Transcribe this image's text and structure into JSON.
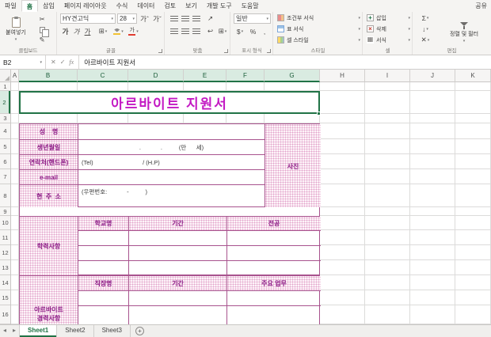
{
  "ribbon": {
    "tabs": [
      {
        "label": "파일"
      },
      {
        "label": "홈"
      },
      {
        "label": "삽입"
      },
      {
        "label": "페이지 레이아웃"
      },
      {
        "label": "수식"
      },
      {
        "label": "데이터"
      },
      {
        "label": "검토"
      },
      {
        "label": "보기"
      },
      {
        "label": "개발 도구"
      },
      {
        "label": "도움말"
      }
    ],
    "active_tab": "홈",
    "share_label": "공유",
    "clipboard": {
      "paste": "붙여넣기",
      "group_label": "클립보드"
    },
    "font": {
      "name": "HY견고딕",
      "size": "28",
      "group_label": "글꼴"
    },
    "alignment": {
      "group_label": "맞춤"
    },
    "number": {
      "format": "일반",
      "group_label": "표시 형식"
    },
    "styles": {
      "buttons": [
        "조건부 서식",
        "표 서식",
        "셀 스타일"
      ],
      "group_label": "스타일"
    },
    "cells": {
      "buttons": [
        "삽입",
        "삭제",
        "서식"
      ],
      "group_label": "셀"
    },
    "editing": {
      "sort_filter": "정렬 및 필터",
      "group_label": "편집"
    }
  },
  "icons": {
    "dropdown": "▾",
    "cut": "✂",
    "format_painter": "✎",
    "font_grow": "가ˆ",
    "font_shrink": "가ˇ",
    "bold": "가",
    "italic": "가",
    "underline": "가",
    "borders": "⊞",
    "font_color": "가",
    "orientation": "↗",
    "wrap_text": "↩",
    "merge": "⊞",
    "currency": "$",
    "percent": "%",
    "comma": ",",
    "sigma": "Σ",
    "fill_down": "↓",
    "clear": "✕",
    "insert_plus": "+",
    "delete_x": "×",
    "format_cell": "▦",
    "cancel": "✕",
    "enter": "✓",
    "fx": "fx",
    "nav_prev": "◂",
    "nav_next": "▸",
    "add_sheet": "+"
  },
  "formula_bar": {
    "name_box": "B2",
    "formula": "아르바이트 지원서"
  },
  "grid": {
    "column_headers": [
      "A",
      "B",
      "C",
      "D",
      "E",
      "F",
      "G",
      "H",
      "I",
      "J",
      "K"
    ],
    "row_headers": [
      "1",
      "2",
      "3",
      "4",
      "5",
      "6",
      "7",
      "8",
      "9",
      "10",
      "11",
      "12",
      "13",
      "14",
      "15",
      "16"
    ],
    "selected_columns": [
      "B",
      "C",
      "D",
      "E",
      "F",
      "G"
    ],
    "selected_row": "2"
  },
  "form": {
    "title": "아르바이트 지원서",
    "photo_label": "사진",
    "personal": [
      {
        "label": "성    명",
        "value": ""
      },
      {
        "label": "생년월일",
        "value": ".            .          (만      세)"
      },
      {
        "label": "연락처(핸드폰)",
        "value": "(Tel)                              / (H.P)"
      },
      {
        "label": "e-mail",
        "value": ""
      },
      {
        "label": "현  주  소",
        "value": "(우편번호:            -          )"
      }
    ],
    "education": {
      "label": "학력사항",
      "headers": [
        "학교명",
        "기간",
        "전공"
      ]
    },
    "career": {
      "label": "아르바이트\n경력사항",
      "headers": [
        "직장명",
        "기간",
        "주요 업무"
      ]
    }
  },
  "sheet_tabs": [
    "Sheet1",
    "Sheet2",
    "Sheet3"
  ],
  "active_sheet": "Sheet1",
  "colors": {
    "title_text": "#c319c3",
    "form_border": "#a8538e",
    "label_text": "#8c1b86",
    "selection_green": "#217346",
    "pattern_dot": "#e2a4cb",
    "pattern_bg": "#fdf4f9"
  }
}
